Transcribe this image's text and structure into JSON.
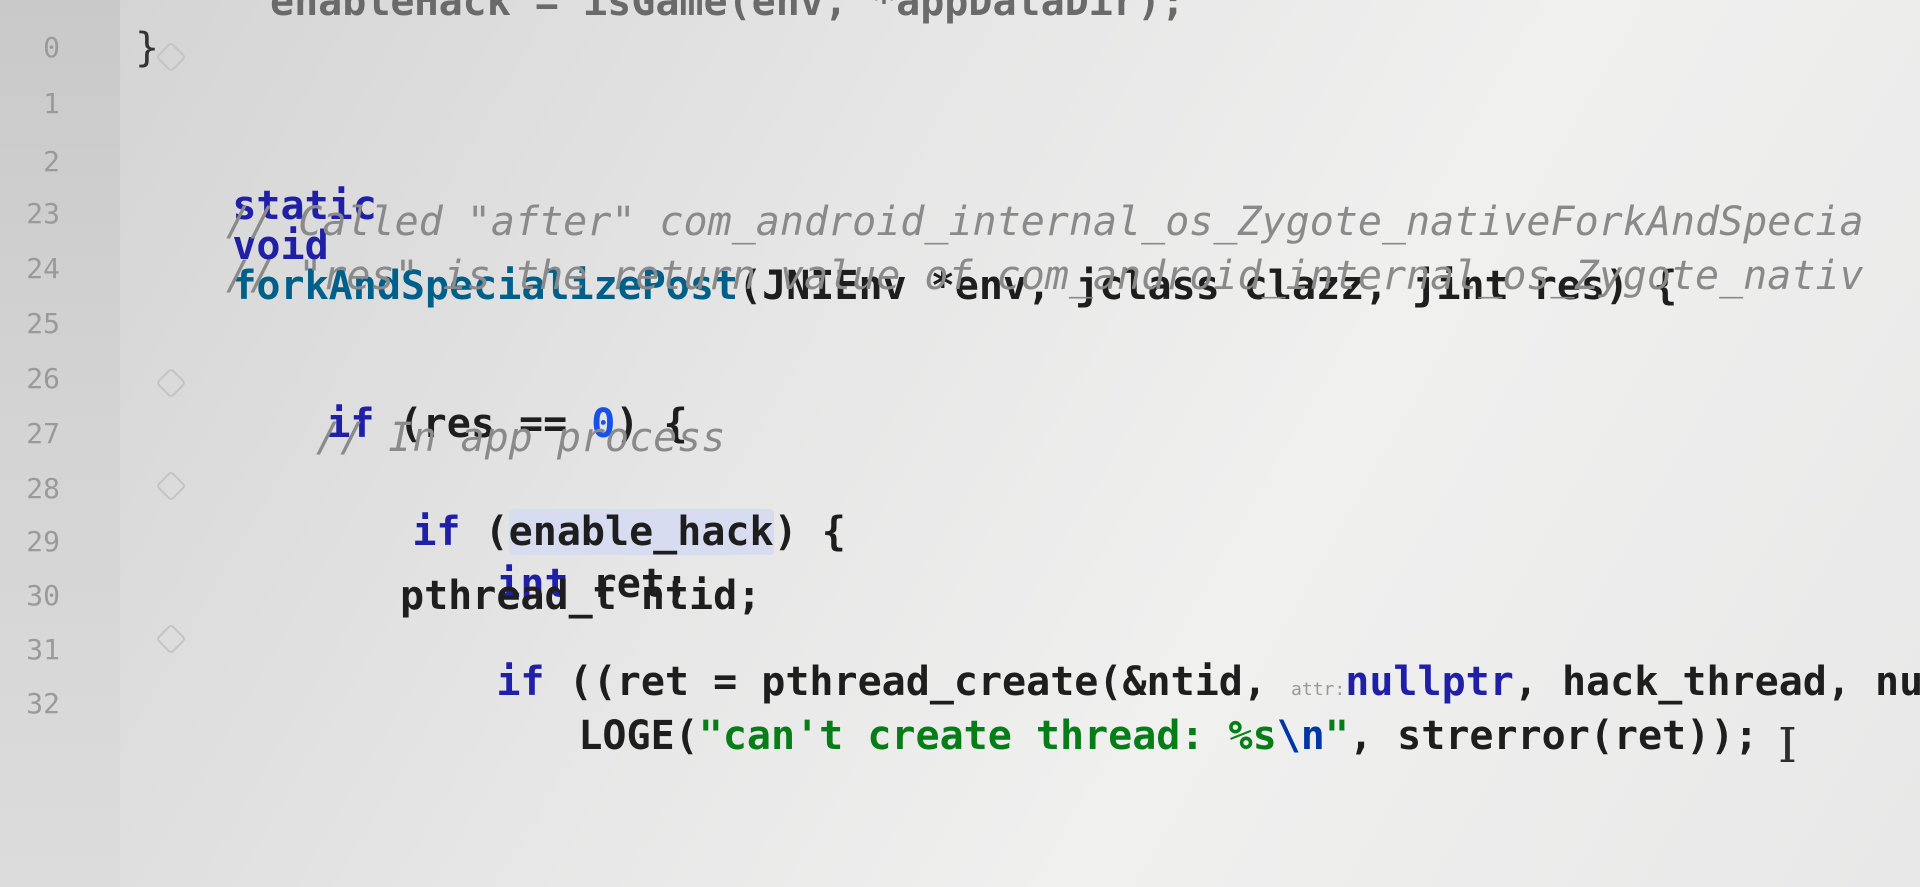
{
  "line_numbers": [
    "0",
    "1",
    "2",
    "23",
    "24",
    "25",
    "26",
    "27",
    "28",
    "29",
    "30",
    "31",
    "32"
  ],
  "code": {
    "top_partial": "enableHack = isGame(env, *appDataDir);",
    "close_brace": "}",
    "func_static": "static",
    "func_void": "void",
    "func_name": "forkAndSpecializePost",
    "func_params": "(JNIEnv *env, jclass clazz, jint res) {",
    "comment_1": "// Called \"after\" com_android_internal_os_Zygote_nativeForkAndSpecia",
    "comment_2": "// \"res\" is the return value of com_android_internal_os_Zygote_nativ",
    "if_1_kw": "if",
    "if_1_open": " (res == ",
    "if_1_num": "0",
    "if_1_close": ") {",
    "comment_3": "// In app process",
    "if_2_kw": "if",
    "if_2_open": " (",
    "if_2_var": "enable_hack",
    "if_2_close": ") {",
    "int_kw": "int",
    "int_rest": " ret;",
    "pthread_decl": "pthread_t ntid;",
    "if_3_kw": "if",
    "if_3_call": " ((ret = pthread_create(&ntid, ",
    "if_3_hint": "attr:",
    "if_3_null": "nullptr",
    "if_3_rest": ", hack_thread, nul",
    "loge_name": "LOGE(",
    "loge_str_1": "\"can't create thread: %s",
    "loge_esc": "\\n",
    "loge_str_2": "\"",
    "loge_rest": ", strerror(ret));"
  }
}
